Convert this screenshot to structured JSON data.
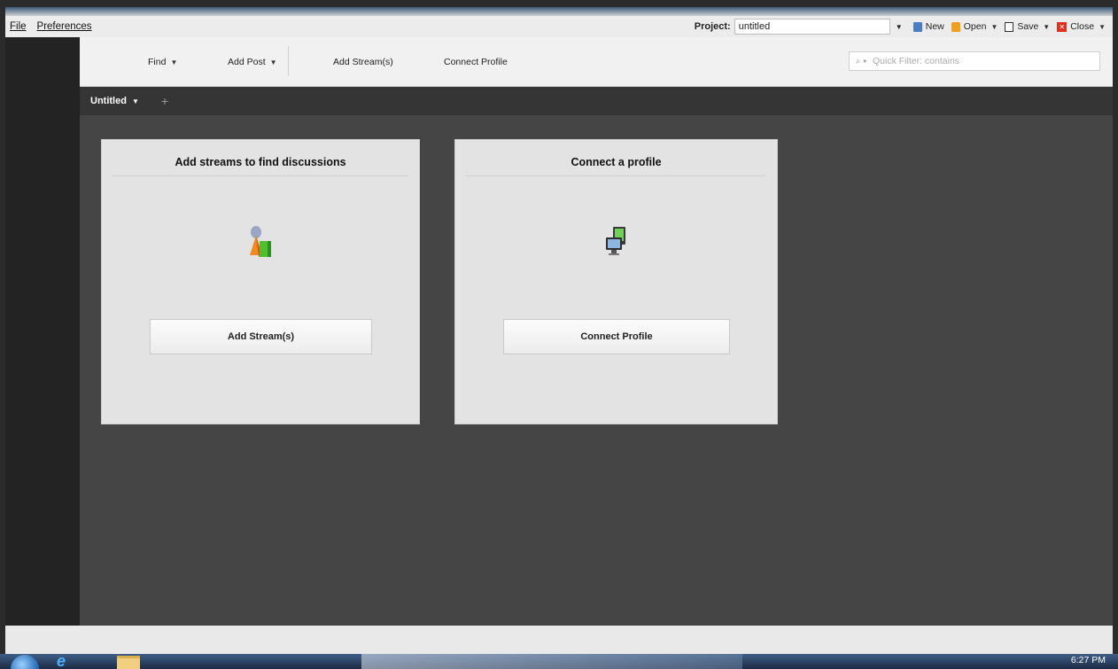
{
  "menubar": {
    "items": [
      {
        "label": "File"
      },
      {
        "label": "Preferences"
      }
    ]
  },
  "project": {
    "label": "Project:",
    "value": "untitled",
    "actions": [
      {
        "label": "New",
        "icon": "new-document-icon"
      },
      {
        "label": "Open",
        "icon": "open-folder-icon"
      },
      {
        "label": "Save",
        "icon": "save-disk-icon"
      },
      {
        "label": "Close",
        "icon": "close-icon"
      }
    ]
  },
  "toolbar": {
    "find": "Find",
    "add_post": "Add Post",
    "add_streams": "Add Stream(s)",
    "connect_profile": "Connect Profile",
    "filter_placeholder": "Quick Filter: contains"
  },
  "tabs": {
    "active": "Untitled",
    "add_icon": "plus-icon"
  },
  "cards": [
    {
      "title": "Add streams to find discussions",
      "icon": "streams-chart-icon",
      "button": "Add Stream(s)"
    },
    {
      "title": "Connect a profile",
      "icon": "connect-computer-icon",
      "button": "Connect Profile"
    }
  ],
  "taskbar": {
    "time": "6:27 PM"
  },
  "colors": {
    "sidebar": "#232323",
    "content": "#454545",
    "tabbar": "#353535",
    "card": "#e3e3e3"
  }
}
